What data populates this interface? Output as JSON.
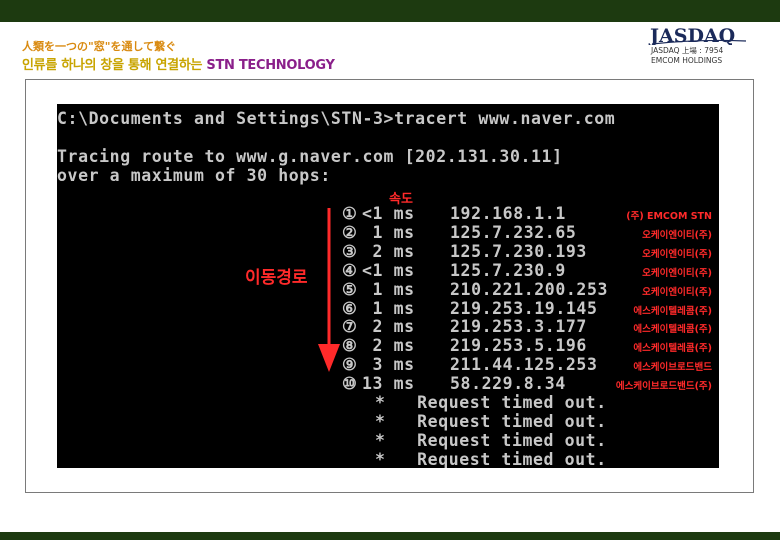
{
  "header": {
    "slogan_jp": "人類を一つの\"窓\"を通して繋ぐ",
    "slogan_ko": "인류를 하나의 창을 통해 연결하는",
    "company": "STN TECHNOLOGY",
    "logo": "JASDAQ",
    "listing_line1": "JASDAQ 上場 : 7954",
    "listing_line2": "EMCOM HOLDINGS"
  },
  "terminal": {
    "prompt": "C:\\Documents and Settings\\STN-3>tracert www.naver.com",
    "tracing_line1": "Tracing route to www.g.naver.com [202.131.30.11]",
    "tracing_line2": "over a maximum of 30 hops:",
    "speed_label": "속도",
    "path_label": "이동경로",
    "hops": [
      {
        "num": "①",
        "time": "<1 ms",
        "ip": "192.168.1.1",
        "isp": "(주) EMCOM STN"
      },
      {
        "num": "②",
        "time": " 1 ms",
        "ip": "125.7.232.65",
        "isp": "오케이엔이티(주)"
      },
      {
        "num": "③",
        "time": " 2 ms",
        "ip": "125.7.230.193",
        "isp": "오케이엔이티(주)"
      },
      {
        "num": "④",
        "time": "<1 ms",
        "ip": "125.7.230.9",
        "isp": "오케이엔이티(주)"
      },
      {
        "num": "⑤",
        "time": " 1 ms",
        "ip": "210.221.200.253",
        "isp": "오케이엔이티(주)"
      },
      {
        "num": "⑥",
        "time": " 1 ms",
        "ip": "219.253.19.145",
        "isp": "에스케이텔레콤(주)"
      },
      {
        "num": "⑦",
        "time": " 2 ms",
        "ip": "219.253.3.177",
        "isp": "에스케이텔레콤(주)"
      },
      {
        "num": "⑧",
        "time": " 2 ms",
        "ip": "219.253.5.196",
        "isp": "에스케이텔레콤(주)"
      },
      {
        "num": "⑨",
        "time": " 3 ms",
        "ip": "211.44.125.253",
        "isp": "에스케이브로드밴드"
      },
      {
        "num": "⑩",
        "time": "13 ms",
        "ip": "58.229.8.34",
        "isp": "에스케이브로드밴드(주)"
      }
    ],
    "timeouts": [
      "*   Request timed out.",
      "*   Request timed out.",
      "*   Request timed out.",
      "*   Request timed out."
    ]
  }
}
